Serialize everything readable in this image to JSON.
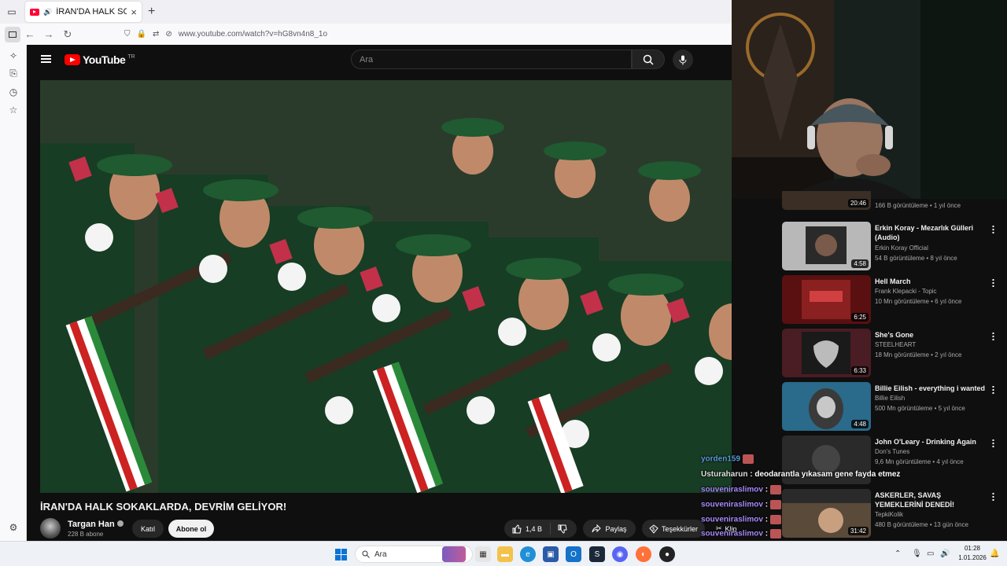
{
  "browser": {
    "tab_title": "İRAN'DA HALK SOKAKLARDA, DEVRİM GELİYOR!",
    "new_tab": "+",
    "url": "www.youtube.com/watch?v=hG8vn4n8_1o"
  },
  "youtube": {
    "logo_text": "YouTube",
    "logo_region": "TR",
    "search_placeholder": "Ara",
    "video_title": "İRAN'DA HALK SOKAKLARDA, DEVRİM GELİYOR!",
    "channel": {
      "name": "Targan Han",
      "subscribers": "228 B abone"
    },
    "join_label": "Katıl",
    "subscribe_label": "Abone ol",
    "like_count": "1,4 B",
    "share_label": "Paylaş",
    "thanks_label": "Teşekkürler",
    "clip_label": "Klip"
  },
  "recommendations": [
    {
      "title": "",
      "channel": "",
      "meta": "166 B görüntüleme • 1 yıl önce",
      "duration": "20:46",
      "thumb_color": "#3a2e25"
    },
    {
      "title": "Erkin Koray - Mezarlık Gülleri (Audio)",
      "channel": "Erkin Koray Official",
      "meta": "54 B görüntüleme • 8 yıl önce",
      "duration": "4:58",
      "thumb_color": "#8a8a8a"
    },
    {
      "title": "Hell March",
      "channel": "Frank Klepacki - Topic",
      "meta": "10 Mn görüntüleme • 6 yıl önce",
      "duration": "6:25",
      "thumb_color": "#6a1818"
    },
    {
      "title": "She's Gone",
      "channel": "STEELHEART",
      "meta": "18 Mn görüntüleme • 2 yıl önce",
      "duration": "6:33",
      "thumb_color": "#2a2a2a"
    },
    {
      "title": "Billie Eilish - everything i wanted",
      "channel": "Billie Eilish",
      "meta": "500 Mn görüntüleme • 5 yıl önce",
      "duration": "4:48",
      "thumb_color": "#1e4e6a"
    },
    {
      "title": "John O'Leary - Drinking Again",
      "channel": "Don's Tunes",
      "meta": "9,6 Mn görüntüleme • 4 yıl önce",
      "duration": "",
      "thumb_color": "#333333"
    },
    {
      "title": "ASKERLER, SAVAŞ YEMEKLERİNİ DENEDİ!",
      "channel": "TepkiKolik",
      "meta": "480 B görüntüleme • 13 gün önce",
      "duration": "31:42",
      "thumb_color": "#5a4030"
    }
  ],
  "chat": [
    {
      "user": "yorden159",
      "message": ""
    },
    {
      "user": "Usturaharun",
      "message": ": deodarantla yıkasam gene fayda etmez"
    },
    {
      "user": "souveniraslimov",
      "message": ":"
    },
    {
      "user": "souveniraslimov",
      "message": ":"
    },
    {
      "user": "souveniraslimov",
      "message": ":"
    },
    {
      "user": "souveniraslimov",
      "message": ":"
    }
  ],
  "taskbar": {
    "search_placeholder": "Ara",
    "time": "01:28",
    "date": "1.01.2026"
  },
  "colors": {
    "yt_red": "#ff0000",
    "yt_bg": "#0f0f0f",
    "chat_user": "#a78bfa",
    "win_blue": "#0b74d6"
  }
}
